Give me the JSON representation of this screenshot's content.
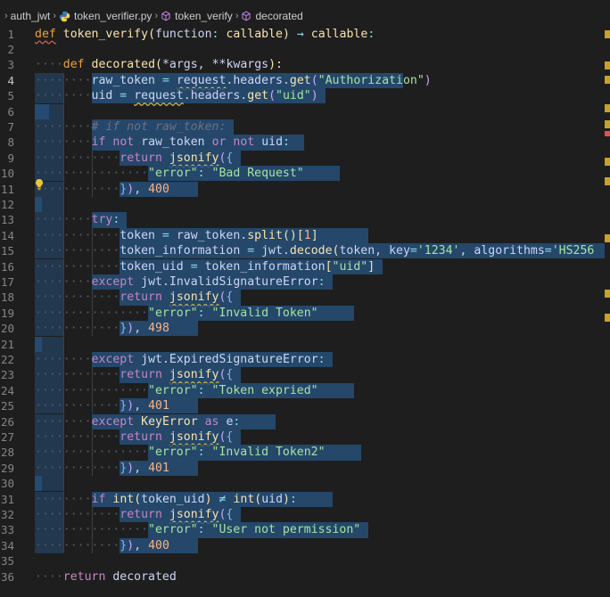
{
  "breadcrumb": {
    "items": [
      "auth_jwt",
      "token_verifier.py",
      "token_verify",
      "decorated"
    ]
  },
  "editor": {
    "active_line": 4,
    "lines": [
      {
        "n": "1"
      },
      {
        "n": "2"
      },
      {
        "n": "3"
      },
      {
        "n": "4"
      },
      {
        "n": "5"
      },
      {
        "n": "6"
      },
      {
        "n": "7"
      },
      {
        "n": "8"
      },
      {
        "n": "9"
      },
      {
        "n": "10"
      },
      {
        "n": "11"
      },
      {
        "n": "12"
      },
      {
        "n": "13"
      },
      {
        "n": "14"
      },
      {
        "n": "15"
      },
      {
        "n": "16"
      },
      {
        "n": "17"
      },
      {
        "n": "18"
      },
      {
        "n": "19"
      },
      {
        "n": "20"
      },
      {
        "n": "21"
      },
      {
        "n": "22"
      },
      {
        "n": "23"
      },
      {
        "n": "24"
      },
      {
        "n": "25"
      },
      {
        "n": "26"
      },
      {
        "n": "27"
      },
      {
        "n": "28"
      },
      {
        "n": "29"
      },
      {
        "n": "30"
      },
      {
        "n": "31"
      },
      {
        "n": "32"
      },
      {
        "n": "33"
      },
      {
        "n": "34"
      },
      {
        "n": "35"
      },
      {
        "n": "36"
      }
    ],
    "code": {
      "l1": {
        "def": "def",
        "name": "token_verify",
        "param": "function",
        "type": "callable",
        "arrow": "→",
        "ret": "callable"
      },
      "l3": {
        "def": "def",
        "name": "decorated",
        "args": "*args",
        "kwargs": "**kwargs"
      },
      "l4": {
        "var": "raw_token",
        "obj": "request",
        "attr": "headers",
        "meth": "get",
        "arg": "\"Authorization\""
      },
      "l5": {
        "var": "uid",
        "obj": "request",
        "attr": "headers",
        "meth": "get",
        "arg": "\"uid\""
      },
      "l7": {
        "comment": "# if not raw_token:"
      },
      "l8": {
        "kw": "if",
        "not1": "not",
        "v1": "raw_token",
        "or": "or",
        "not2": "not",
        "v2": "uid"
      },
      "l9": {
        "ret": "return",
        "fn": "jsonify"
      },
      "l10": {
        "key": "\"error\"",
        "val": "\"Bad Request\""
      },
      "l11": {
        "num": "400"
      },
      "l13": {
        "kw": "try"
      },
      "l14": {
        "var": "token",
        "src": "raw_token",
        "meth": "split",
        "idx": "1"
      },
      "l15": {
        "var": "token_information",
        "mod": "jwt",
        "meth": "decode",
        "a1": "token",
        "k1": "key",
        "v1": "'1234'",
        "k2": "algorithms",
        "v2": "'HS256"
      },
      "l16": {
        "var": "token_uid",
        "src": "token_information",
        "key": "\"uid\""
      },
      "l17": {
        "kw": "except",
        "mod": "jwt",
        "exc": "InvalidSignatureError"
      },
      "l18": {
        "ret": "return",
        "fn": "jsonify"
      },
      "l19": {
        "key": "\"error\"",
        "val": "\"Invalid Token\""
      },
      "l20": {
        "num": "498"
      },
      "l22": {
        "kw": "except",
        "mod": "jwt",
        "exc": "ExpiredSignatureError"
      },
      "l23": {
        "ret": "return",
        "fn": "jsonify"
      },
      "l24": {
        "key": "\"error\"",
        "val": "\"Token expried\""
      },
      "l25": {
        "num": "401"
      },
      "l26": {
        "kw": "except",
        "exc": "KeyError",
        "as": "as",
        "e": "e"
      },
      "l27": {
        "ret": "return",
        "fn": "jsonify"
      },
      "l28": {
        "key": "\"error\"",
        "val": "\"Invalid Token2\""
      },
      "l29": {
        "num": "401"
      },
      "l31": {
        "kw": "if",
        "int1": "int",
        "a1": "token_uid",
        "ne": "≠",
        "int2": "int",
        "a2": "uid"
      },
      "l32": {
        "ret": "return",
        "fn": "jsonify"
      },
      "l33": {
        "key": "\"error\"",
        "val": "\"User not permission\""
      },
      "l34": {
        "num": "400"
      },
      "l36": {
        "ret": "return",
        "v": "decorated"
      }
    }
  },
  "colors": {
    "background": "#1e1e1e",
    "selection": "#264f78",
    "keyword": "#c586c0",
    "string": "#a6e3a1",
    "number": "#fab387",
    "warning_mark": "#c9a227"
  },
  "icons": {
    "file": "python-icon",
    "symbol": "cube-icon",
    "hint": "lightbulb-icon"
  }
}
